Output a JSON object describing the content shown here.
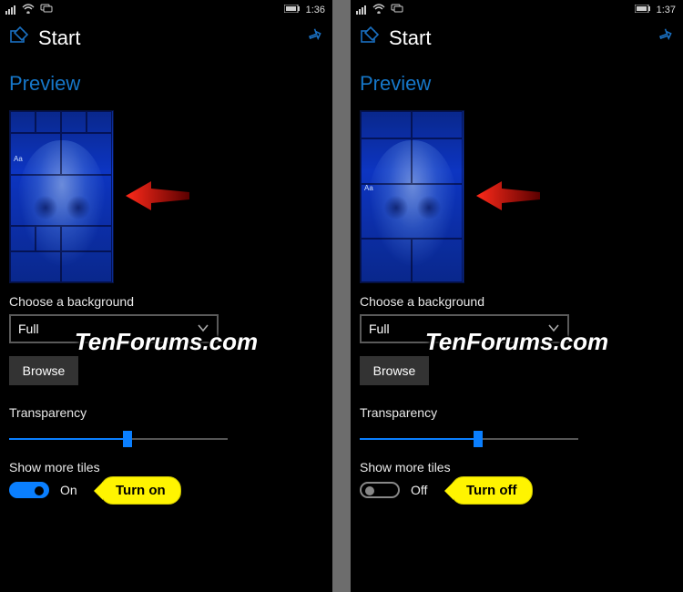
{
  "left": {
    "status": {
      "time": "1:36"
    },
    "header": {
      "title": "Start"
    },
    "preview_label": "Preview",
    "aa_label": "Aa",
    "choose_label": "Choose a background",
    "select_value": "Full",
    "browse_label": "Browse",
    "transparency_label": "Transparency",
    "slider_value_pct": 54,
    "tiles_label": "Show more tiles",
    "toggle": {
      "state": "on",
      "text": "On"
    },
    "bubble_text": "Turn on",
    "watermark": "TenForums.com"
  },
  "right": {
    "status": {
      "time": "1:37"
    },
    "header": {
      "title": "Start"
    },
    "preview_label": "Preview",
    "aa_label": "Aa",
    "choose_label": "Choose a background",
    "select_value": "Full",
    "browse_label": "Browse",
    "transparency_label": "Transparency",
    "slider_value_pct": 54,
    "tiles_label": "Show more tiles",
    "toggle": {
      "state": "off",
      "text": "Off"
    },
    "bubble_text": "Turn off",
    "watermark": "TenForums.com"
  }
}
